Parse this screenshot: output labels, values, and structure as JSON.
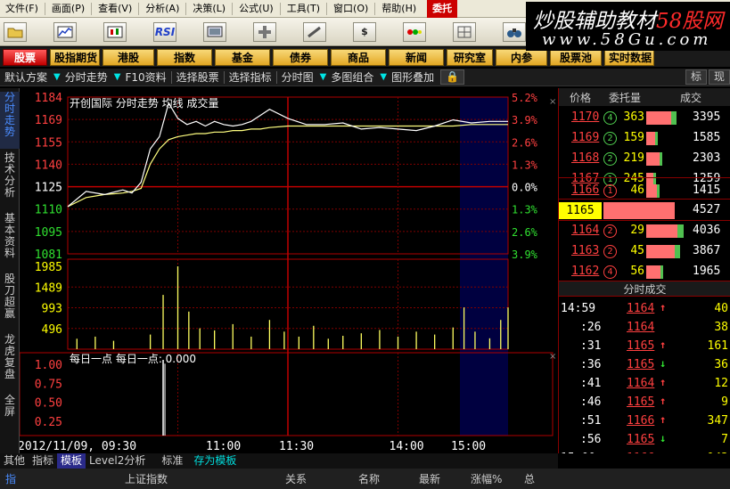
{
  "menu": [
    "文件(F)",
    "画面(P)",
    "查看(V)",
    "分析(A)",
    "决策(L)",
    "公式(U)",
    "工具(T)",
    "窗口(O)",
    "帮助(H)",
    "委托"
  ],
  "toolbar": {
    "rsi_label": "RSI",
    "dollar_label": "$"
  },
  "watermark": {
    "line1_a": "炒股辅助教材",
    "line1_b": "58股网",
    "line2": "www.58Gu.com"
  },
  "categories": [
    "股票",
    "股指期货",
    "港股",
    "指数",
    "基金",
    "债券",
    "商品",
    "新闻",
    "研究室",
    "内参",
    "股票池",
    "实时数据"
  ],
  "options": {
    "default_scheme": "默认方案",
    "intraday": "分时走势",
    "f10": "F10资料",
    "select_stock": "选择股票",
    "select_indicator": "选择指标",
    "timechart": "分时图",
    "multi": "多图组合",
    "overlay": "图形叠加",
    "lock": "🔒",
    "tab_mark": "标",
    "tab_now": "现"
  },
  "left_tabs": [
    "分时走势",
    "技术分析",
    "基本资料",
    "股刀超赢",
    "龙虎复盘",
    "全屏"
  ],
  "chart_data": {
    "type": "line",
    "title": "开创国际 分时走势 均线 成交量",
    "price_ticks": [
      1184,
      1169,
      1155,
      1140,
      1125,
      1110,
      1095,
      1081
    ],
    "pct_ticks": [
      "5.2%",
      "3.9%",
      "2.6%",
      "1.3%",
      "0.0%",
      "1.3%",
      "2.6%",
      "3.9%"
    ],
    "volume_ticks": [
      1985,
      1489,
      993,
      496
    ],
    "indicator_title": "每日一点 每日一点: 0.000",
    "indicator_ticks": [
      "1.00",
      "0.75",
      "0.50",
      "0.25"
    ],
    "x_labels": [
      "2012/11/09, 09:30",
      "11:00",
      "11:30",
      "14:00",
      "15:00"
    ],
    "ylim": [
      1081,
      1184
    ],
    "prev_close": 1125,
    "price_x_index": [
      0,
      10,
      20,
      30,
      35,
      40,
      45,
      50,
      55,
      60,
      65,
      70,
      75,
      80,
      85,
      90,
      95,
      100,
      105,
      110,
      120,
      130,
      140,
      150,
      160,
      170,
      180,
      190,
      200,
      210,
      220,
      230,
      240
    ],
    "price": [
      1112,
      1122,
      1120,
      1123,
      1121,
      1128,
      1150,
      1158,
      1180,
      1170,
      1166,
      1168,
      1165,
      1168,
      1166,
      1165,
      1166,
      1168,
      1172,
      1176,
      1170,
      1166,
      1166,
      1167,
      1163,
      1164,
      1163,
      1162,
      1165,
      1169,
      1167,
      1168,
      1168
    ],
    "avg": [
      1112,
      1118,
      1120,
      1121,
      1122,
      1124,
      1140,
      1150,
      1156,
      1158,
      1159,
      1160,
      1160,
      1161,
      1161,
      1162,
      1162,
      1163,
      1163,
      1164,
      1165,
      1165,
      1165,
      1165,
      1165,
      1165,
      1165,
      1165,
      1165,
      1165,
      1166,
      1166,
      1166
    ],
    "volume_x_index": [
      5,
      15,
      25,
      45,
      52,
      60,
      66,
      72,
      80,
      90,
      100,
      110,
      118,
      126,
      134,
      142,
      150,
      160,
      170,
      180,
      190,
      200,
      210,
      216,
      222,
      230,
      236,
      240
    ],
    "volume": [
      250,
      300,
      200,
      350,
      1300,
      1985,
      900,
      500,
      450,
      600,
      300,
      700,
      420,
      300,
      560,
      250,
      320,
      380,
      460,
      300,
      420,
      350,
      520,
      1000,
      420,
      260,
      700,
      1000
    ],
    "indicator_spike": 1.0
  },
  "orderbook": {
    "headers": [
      "价格",
      "委托量",
      "成交"
    ],
    "asks": [
      {
        "price": "1170",
        "level": "4",
        "vol": "363",
        "total": "3395",
        "bar": 28
      },
      {
        "price": "1169",
        "level": "2",
        "vol": "159",
        "total": "1585",
        "bar": 10
      },
      {
        "price": "1168",
        "level": "2",
        "vol": "219",
        "total": "2303",
        "bar": 15
      },
      {
        "price": "1167",
        "level": "1",
        "vol": "245",
        "total": "1259",
        "bar": 8
      }
    ],
    "bids": [
      {
        "price": "1166",
        "level": "1",
        "vol": "46",
        "total": "1415",
        "bar": 12
      },
      {
        "price": "1164",
        "level": "2",
        "vol": "29",
        "total": "4036",
        "bar": 35
      },
      {
        "price": "1163",
        "level": "2",
        "vol": "45",
        "total": "3867",
        "bar": 32
      },
      {
        "price": "1162",
        "level": "4",
        "vol": "56",
        "total": "1965",
        "bar": 16
      }
    ],
    "current": {
      "price": "1165",
      "total": "4527"
    }
  },
  "timesales": {
    "title": "分时成交",
    "rows": [
      {
        "time": "14:59",
        "price": "1164",
        "dir": "up",
        "vol": "40"
      },
      {
        "time": ":26",
        "price": "1164",
        "dir": "none",
        "vol": "38"
      },
      {
        "time": ":31",
        "price": "1165",
        "dir": "up",
        "vol": "161"
      },
      {
        "time": ":36",
        "price": "1165",
        "dir": "down",
        "vol": "36"
      },
      {
        "time": ":41",
        "price": "1164",
        "dir": "up",
        "vol": "12"
      },
      {
        "time": ":46",
        "price": "1165",
        "dir": "up",
        "vol": "9"
      },
      {
        "time": ":51",
        "price": "1166",
        "dir": "up",
        "vol": "347"
      },
      {
        "time": ":56",
        "price": "1165",
        "dir": "down",
        "vol": "7"
      },
      {
        "time": "15:00",
        "price": "1166",
        "dir": "up",
        "vol": "143"
      },
      {
        "time": ":06",
        "price": "1165",
        "dir": "down",
        "vol": "4"
      }
    ]
  },
  "bottom": {
    "row1": [
      "其他",
      "指标",
      "模板",
      "Level2分析",
      "标准",
      "存为模板"
    ],
    "row2_left": "指",
    "row2": [
      "上证指数",
      "关系",
      "名称",
      "最新",
      "涨幅%",
      "总"
    ]
  }
}
